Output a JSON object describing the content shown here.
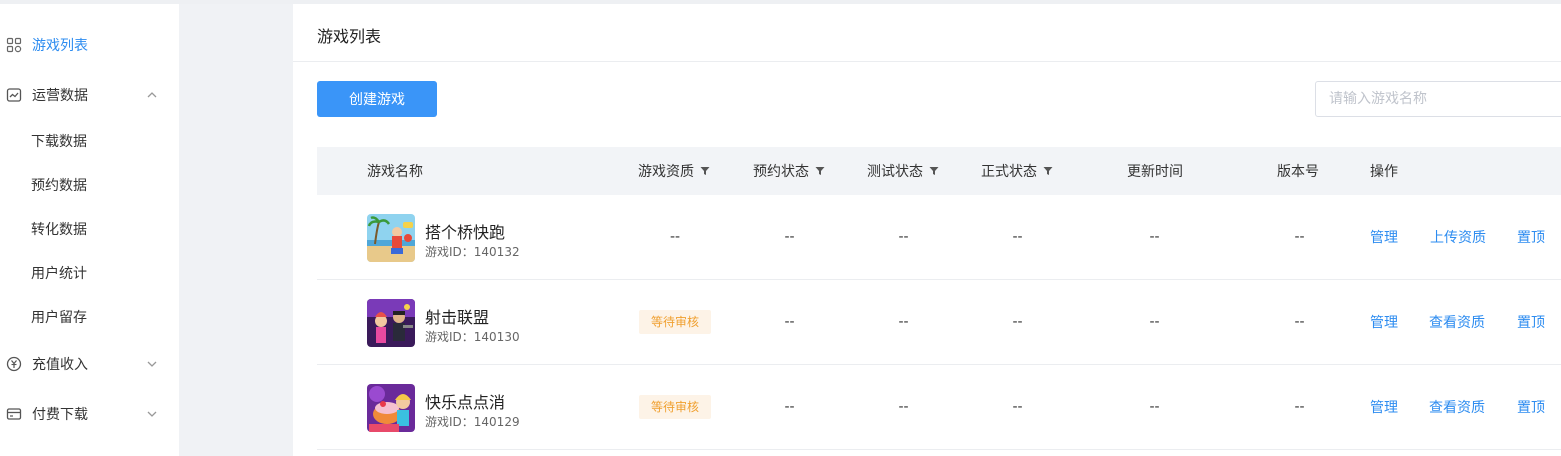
{
  "sidebar": {
    "items": [
      {
        "label": "游戏列表",
        "icon": "grid-icon",
        "active": true
      },
      {
        "label": "运营数据",
        "icon": "chart-box-icon",
        "expanded": true
      },
      {
        "label": "充值收入",
        "icon": "yen-circle-icon",
        "expanded": false
      },
      {
        "label": "付费下载",
        "icon": "card-icon",
        "expanded": false
      }
    ],
    "subitems": [
      "下载数据",
      "预约数据",
      "转化数据",
      "用户统计",
      "用户留存"
    ]
  },
  "main": {
    "title": "游戏列表",
    "create_button": "创建游戏",
    "search_placeholder": "请输入游戏名称",
    "columns": [
      "游戏名称",
      "游戏资质",
      "预约状态",
      "测试状态",
      "正式状态",
      "更新时间",
      "版本号",
      "操作"
    ],
    "rows": [
      {
        "name": "搭个桥快跑",
        "id": "游戏ID：140132",
        "qualification": "--",
        "reserve": "--",
        "test": "--",
        "release": "--",
        "updated": "--",
        "version": "--",
        "actions": [
          "管理",
          "上传资质",
          "置顶"
        ]
      },
      {
        "name": "射击联盟",
        "id": "游戏ID：140130",
        "qualification": "等待审核",
        "reserve": "--",
        "test": "--",
        "release": "--",
        "updated": "--",
        "version": "--",
        "actions": [
          "管理",
          "查看资质",
          "置顶"
        ]
      },
      {
        "name": "快乐点点消",
        "id": "游戏ID：140129",
        "qualification": "等待审核",
        "reserve": "--",
        "test": "--",
        "release": "--",
        "updated": "--",
        "version": "--",
        "actions": [
          "管理",
          "查看资质",
          "置顶"
        ]
      }
    ]
  },
  "colors": {
    "accent": "#2d8cf0",
    "button": "#3a95f8",
    "badge_bg": "#fdf3e7",
    "badge_text": "#f0a030"
  }
}
